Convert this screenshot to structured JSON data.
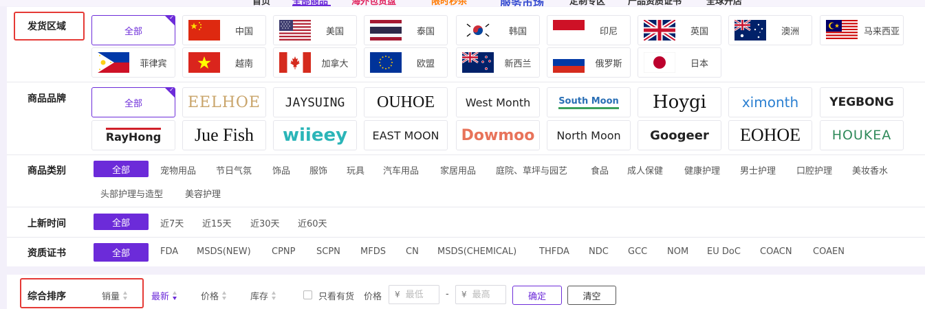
{
  "topnav": {
    "items": [
      "首页",
      "全部商品",
      "海外包货盘",
      "限时秒杀",
      "服务市场",
      "定制专区",
      "产品资质证书",
      "全球开店"
    ]
  },
  "region": {
    "label": "发货区域",
    "items": [
      {
        "name": "全部",
        "active": true
      },
      {
        "name": "中国",
        "flag": "china-flag-icon"
      },
      {
        "name": "美国",
        "flag": "usa-flag-icon"
      },
      {
        "name": "泰国",
        "flag": "thailand-flag-icon"
      },
      {
        "name": "韩国",
        "flag": "korea-flag-icon"
      },
      {
        "name": "印尼",
        "flag": "indonesia-flag-icon"
      },
      {
        "name": "英国",
        "flag": "uk-flag-icon"
      },
      {
        "name": "澳洲",
        "flag": "australia-flag-icon"
      },
      {
        "name": "马来西亚",
        "flag": "malaysia-flag-icon"
      },
      {
        "name": "菲律宾",
        "flag": "philippines-flag-icon"
      },
      {
        "name": "越南",
        "flag": "vietnam-flag-icon"
      },
      {
        "name": "加拿大",
        "flag": "canada-flag-icon"
      },
      {
        "name": "欧盟",
        "flag": "eu-flag-icon"
      },
      {
        "name": "新西兰",
        "flag": "newzealand-flag-icon"
      },
      {
        "name": "俄罗斯",
        "flag": "russia-flag-icon"
      },
      {
        "name": "日本",
        "flag": "japan-flag-icon"
      }
    ]
  },
  "brand": {
    "label": "商品品牌",
    "items": [
      {
        "name": "全部",
        "active": true
      },
      {
        "name": "EELHOE",
        "color": "#c9a46a"
      },
      {
        "name": "JAYSUING",
        "color": "#222222"
      },
      {
        "name": "OUHOE",
        "color": "#222222"
      },
      {
        "name": "West Month",
        "color": "#222222"
      },
      {
        "name": "South Moon",
        "color": "#2a6fb5"
      },
      {
        "name": "Hoygi",
        "color": "#222222"
      },
      {
        "name": "ximonth",
        "color": "#2a7fd1"
      },
      {
        "name": "YEGBONG",
        "color": "#222222"
      },
      {
        "name": "RayHong",
        "color": "#222222"
      },
      {
        "name": "Jue Fish",
        "color": "#222222"
      },
      {
        "name": "wiieey",
        "color": "#2bb5b8"
      },
      {
        "name": "EAST MOON",
        "color": "#222222"
      },
      {
        "name": "Dowmoo",
        "color": "#e8735a"
      },
      {
        "name": "North Moon",
        "color": "#222222"
      },
      {
        "name": "Googeer",
        "color": "#222222"
      },
      {
        "name": "EOHOE",
        "color": "#222222"
      },
      {
        "name": "HOUKEA",
        "color": "#2f8a5a"
      }
    ]
  },
  "category": {
    "label": "商品类别",
    "items": [
      "全部",
      "宠物用品",
      "节日气氛",
      "饰品",
      "服饰",
      "玩具",
      "汽车用品",
      "家居用品",
      "庭院、草坪与园艺",
      "食品",
      "成人保健",
      "健康护理",
      "男士护理",
      "口腔护理",
      "美妆香水",
      "头部护理与造型",
      "美容护理"
    ]
  },
  "newtime": {
    "label": "上新时间",
    "items": [
      "全部",
      "近7天",
      "近15天",
      "近30天",
      "近60天"
    ]
  },
  "cert": {
    "label": "资质证书",
    "items": [
      "全部",
      "FDA",
      "MSDS(NEW)",
      "CPNP",
      "SCPN",
      "MFDS",
      "CN",
      "MSDS(CHEMICAL)",
      "THFDA",
      "NDC",
      "GCC",
      "NOM",
      "EU DoC",
      "COACN",
      "COAEN"
    ]
  },
  "sort": {
    "label": "综合排序",
    "items": [
      "销量",
      "最新",
      "价格",
      "库存"
    ],
    "in_stock_only": "只看有货",
    "price_label": "价格",
    "currency": "¥",
    "min_placeholder": "最低",
    "max_placeholder": "最高",
    "dash": "-",
    "confirm": "确定",
    "clear": "清空"
  },
  "colors": {
    "accent": "#6c2bd9",
    "highlight_box": "#e53935"
  }
}
